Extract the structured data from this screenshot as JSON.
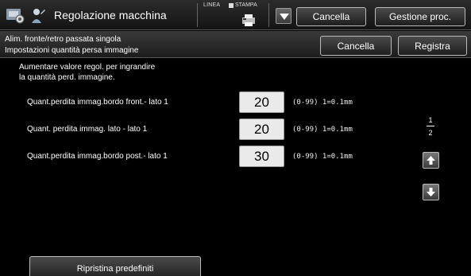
{
  "header": {
    "title": "Regolazione macchina",
    "line_label": "LINEA",
    "print_label": "STAMPA",
    "cancel_label": "Cancella",
    "procedures_label": "Gestione proc.",
    "icons": [
      "machine-settings-icon",
      "user-tool-icon",
      "printer-icon",
      "dropdown-arrow-icon"
    ]
  },
  "subheader": {
    "crumb1": "Alim. fronte/retro passata singola",
    "crumb2": "Impostazioni quantità persa immagine",
    "cancel_label": "Cancella",
    "save_label": "Registra"
  },
  "main": {
    "instruction_line1": "Aumentare valore regol. per ingrandire",
    "instruction_line2": "la quantità perd. immagine.",
    "rows": [
      {
        "label": "Quant.perdita immag.bordo front.- lato 1",
        "value": "20",
        "range": "(0-99) 1=0.1mm"
      },
      {
        "label": "Quant. perdita immag. lato - lato 1",
        "value": "20",
        "range": "(0-99) 1=0.1mm"
      },
      {
        "label": "Quant.perdita immag.bordo post.- lato 1",
        "value": "30",
        "range": "(0-99) 1=0.1mm"
      }
    ],
    "page_current": "1",
    "page_total": "2",
    "reset_label": "Ripristina predefiniti"
  },
  "colors": {
    "background": "#000000",
    "value_box": "#eaeaea",
    "bar": "#1e1e1e"
  }
}
